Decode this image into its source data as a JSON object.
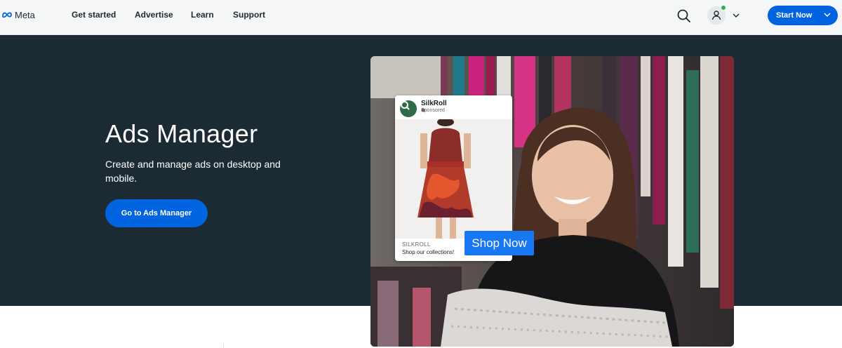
{
  "nav": {
    "logo_text": "Meta",
    "links": [
      {
        "label": "Get started"
      },
      {
        "label": "Advertise"
      },
      {
        "label": "Learn"
      },
      {
        "label": "Support"
      }
    ],
    "search_icon": "search-icon",
    "account_icon": "user-icon",
    "start_now_label": "Start Now"
  },
  "hero": {
    "title": "Ads Manager",
    "subtitle": "Create and manage ads on desktop and mobile.",
    "cta_label": "Go to Ads Manager"
  },
  "ad_preview": {
    "brand": "SilkRoll",
    "sponsored": "Sponsored · ",
    "footer_brand": "SILKROLL",
    "footer_text": "Shop our collections!",
    "button_label": "Shop Now"
  },
  "colors": {
    "hero_bg": "#1c2b33",
    "brand_blue": "#0064e0",
    "nav_bg": "#f5f6f6",
    "ad_button": "#1877f2"
  }
}
